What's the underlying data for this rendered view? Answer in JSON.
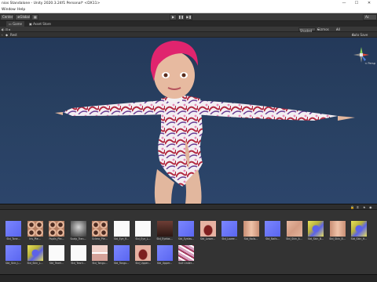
{
  "window": {
    "title": "nios Standalone - Unity 2020.3.24f1 Personal* <DX11>"
  },
  "menu": [
    "Window",
    "Help"
  ],
  "toolbar": {
    "pivot": "Center",
    "space": "Global",
    "play": "▶",
    "pause": "❚❚",
    "step": "▶❚",
    "account": "Ac"
  },
  "tabs": [
    {
      "label": "Game"
    },
    {
      "label": "Asset Store"
    }
  ],
  "scene_toolbar": {
    "shading": "Shaded",
    "gizmos": "Gizmos",
    "search_all": "All"
  },
  "hierarchy": {
    "root": "Rest",
    "auto_save": "Auto Save"
  },
  "gizmo": {
    "label": "< Persp",
    "y": "y",
    "z": "z",
    "x": "x"
  },
  "assets": [
    [
      {
        "label": "Std_Tone...",
        "style": "blue"
      },
      {
        "label": "Iris_Pte...",
        "style": "eyegrid"
      },
      {
        "label": "Pupils_Pte...",
        "style": "eyegrid"
      },
      {
        "label": "Scalp_Tran...",
        "style": "gray"
      },
      {
        "label": "Sclera_Pte...",
        "style": "eyegrid"
      },
      {
        "label": "Std_Eye_R...",
        "style": "white"
      },
      {
        "label": "Std_Eye_L...",
        "style": "white"
      },
      {
        "label": "Std_Eyelas...",
        "style": "dark"
      },
      {
        "label": "Std_Eyelas...",
        "style": "blue"
      },
      {
        "label": "Std_Lower...",
        "style": "mouth"
      },
      {
        "label": "Std_Lower...",
        "style": "blue"
      },
      {
        "label": "Std_Nails...",
        "style": "skinb"
      },
      {
        "label": "Std_Nails...",
        "style": "blue"
      },
      {
        "label": "Std_Skin_A...",
        "style": "skin"
      },
      {
        "label": "Std_Skin_B...",
        "style": "yellow"
      },
      {
        "label": "Std_Skin_B...",
        "style": "skinb"
      },
      {
        "label": "Std_Skin_H...",
        "style": "yellow"
      }
    ],
    [
      {
        "label": "Std_Skin_L...",
        "style": "blue"
      },
      {
        "label": "Std_Skin_L...",
        "style": "yellow"
      },
      {
        "label": "Std_Tearli...",
        "style": "white"
      },
      {
        "label": "Std_Tearli...",
        "style": "white"
      },
      {
        "label": "Std_Tongu...",
        "style": "teeth"
      },
      {
        "label": "Std_Tongu...",
        "style": "blue"
      },
      {
        "label": "Std_Upper...",
        "style": "mouth"
      },
      {
        "label": "Std_Upper...",
        "style": "blue"
      },
      {
        "label": "Suit Under...",
        "style": "floral"
      }
    ]
  ]
}
